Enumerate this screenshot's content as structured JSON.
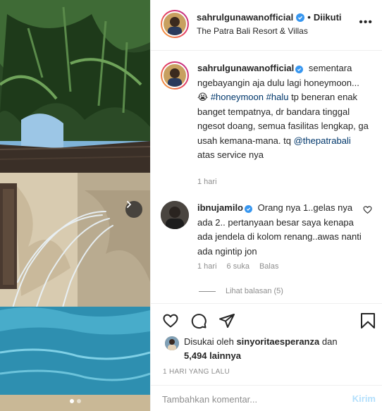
{
  "header": {
    "username": "sahrulgunawanofficial",
    "separator": "•",
    "follow_status": "Diikuti",
    "location": "The Patra Bali Resort & Villas",
    "more_icon": "more-horizontal-icon"
  },
  "caption": {
    "username": "sahrulgunawanofficial",
    "text_1": "sementara ngebayangin aja dulu lagi honeymoon...",
    "emoji": "😭",
    "hashtag_1": "#honeymoon",
    "hashtag_2": "#halu",
    "text_2": "tp beneran enak banget tempatnya, dr bandara tinggal ngesot doang, semua fasilitas lengkap, ga usah kemana-mana. tq",
    "mention": "@thepatrabali",
    "text_3": "atas service nya",
    "time": "1 hari"
  },
  "comment": {
    "username": "ibnujamilo",
    "text": "Orang nya 1..gelas nya ada 2.. pertanyaan besar saya kenapa ada jendela di kolom renang..awas nanti ada ngintip jon",
    "time": "1 hari",
    "likes": "6 suka",
    "reply": "Balas",
    "view_replies": "Lihat balasan (5)"
  },
  "actions": {
    "liked_by_prefix": "Disukai oleh",
    "liked_by_user": "sinyoritaesperanza",
    "liked_by_and": "dan",
    "others_count": "5,494 lainnya",
    "date": "1 HARI YANG LALU"
  },
  "add_comment": {
    "placeholder": "Tambahkan komentar...",
    "post_label": "Kirim"
  },
  "colors": {
    "verified": "#3897f0",
    "link": "#00376b",
    "muted": "#8e8e8e",
    "post_disabled": "#b2dffc"
  }
}
